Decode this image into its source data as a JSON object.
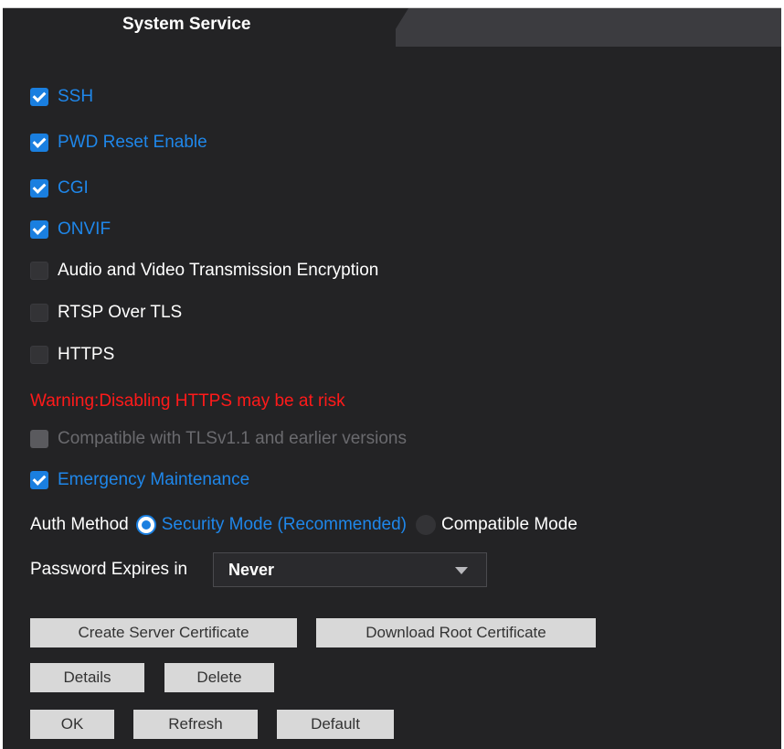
{
  "tab": {
    "title": "System Service"
  },
  "options": [
    {
      "label": "SSH",
      "state": "checked"
    },
    {
      "label": "PWD Reset Enable",
      "state": "checked"
    },
    {
      "label": "CGI",
      "state": "checked"
    },
    {
      "label": "ONVIF",
      "state": "checked"
    },
    {
      "label": "Audio and Video Transmission Encryption",
      "state": "unchecked"
    },
    {
      "label": "RTSP Over TLS",
      "state": "unchecked"
    },
    {
      "label": "HTTPS",
      "state": "unchecked"
    }
  ],
  "warning": "Warning:Disabling HTTPS may be at risk",
  "tls_option": {
    "label": "Compatible with TLSv1.1 and earlier versions",
    "state": "disabled"
  },
  "emergency": {
    "label": "Emergency Maintenance",
    "state": "checked"
  },
  "auth": {
    "label": "Auth Method",
    "options": [
      {
        "label": "Security Mode (Recommended)",
        "selected": true
      },
      {
        "label": "Compatible Mode",
        "selected": false
      }
    ]
  },
  "password_expiry": {
    "label": "Password Expires in",
    "value": "Never"
  },
  "buttons": {
    "create_cert": "Create Server Certificate",
    "download_root": "Download Root Certificate",
    "details": "Details",
    "delete": "Delete",
    "ok": "OK",
    "refresh": "Refresh",
    "default": "Default"
  },
  "colors": {
    "panel_bg": "#232325",
    "accent_blue": "#1a7fe0",
    "warning_red": "#ff1a1a",
    "button_bg": "#d8d8d8"
  }
}
